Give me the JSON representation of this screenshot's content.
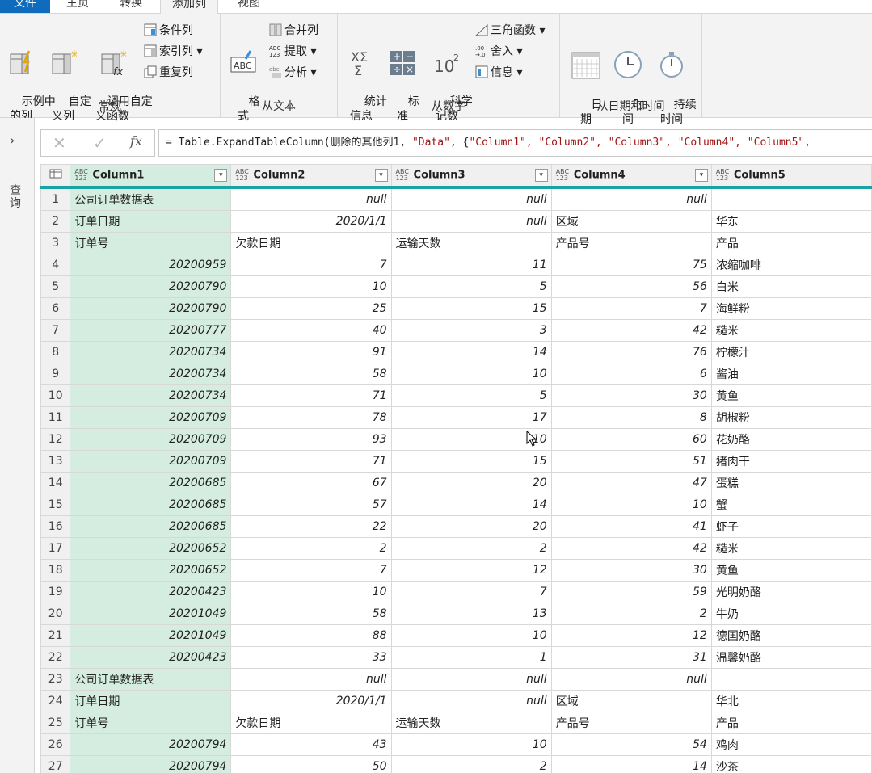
{
  "tabs": [
    "文件",
    "主页",
    "转换",
    "添加列",
    "视图"
  ],
  "ribbon": {
    "general": {
      "label": "常规",
      "example_col": "示例中\n的列",
      "custom_col": "自定\n义列",
      "invoke_func": "调用自定\n义函数",
      "conditional": "条件列",
      "index": "索引列",
      "duplicate": "重复列"
    },
    "text": {
      "label": "从文本",
      "format": "格\n式",
      "merge": "合并列",
      "extract": "提取",
      "parse": "分析"
    },
    "number": {
      "label": "从数字",
      "stats": "统计\n信息",
      "standard": "标\n准",
      "scientific": "科学\n记数",
      "trig": "三角函数",
      "round": "舍入",
      "info": "信息"
    },
    "datetime": {
      "label": "从日期和时间",
      "date": "日\n期",
      "time": "时\n间",
      "duration": "持续\n时间"
    }
  },
  "nav": {
    "label": "查询"
  },
  "formula": {
    "prefix": "= Table.ExpandTableColumn(删除的其他列1, ",
    "s1": "\"Data\"",
    "mid": ", {",
    "s2": "\"Column1\", \"Column2\", \"Column3\", \"Column4\", \"Column5\","
  },
  "columns": [
    "Column1",
    "Column2",
    "Column3",
    "Column4",
    "Column5"
  ],
  "type_icon": "ABC\n123",
  "rows": [
    [
      "1",
      "公司订单数据表",
      "null",
      "null",
      "null",
      ""
    ],
    [
      "2",
      "订单日期",
      "2020/1/1",
      "null",
      "区域",
      "华东"
    ],
    [
      "3",
      "订单号",
      "欠款日期",
      "运输天数",
      "产品号",
      "产品"
    ],
    [
      "4",
      "20200959",
      "7",
      "11",
      "75",
      "浓缩咖啡"
    ],
    [
      "5",
      "20200790",
      "10",
      "5",
      "56",
      "白米"
    ],
    [
      "6",
      "20200790",
      "25",
      "15",
      "7",
      "海鲜粉"
    ],
    [
      "7",
      "20200777",
      "40",
      "3",
      "42",
      "糙米"
    ],
    [
      "8",
      "20200734",
      "91",
      "14",
      "76",
      "柠檬汁"
    ],
    [
      "9",
      "20200734",
      "58",
      "10",
      "6",
      "酱油"
    ],
    [
      "10",
      "20200734",
      "71",
      "5",
      "30",
      "黄鱼"
    ],
    [
      "11",
      "20200709",
      "78",
      "17",
      "8",
      "胡椒粉"
    ],
    [
      "12",
      "20200709",
      "93",
      "10",
      "60",
      "花奶酪"
    ],
    [
      "13",
      "20200709",
      "71",
      "15",
      "51",
      "猪肉干"
    ],
    [
      "14",
      "20200685",
      "67",
      "20",
      "47",
      "蛋糕"
    ],
    [
      "15",
      "20200685",
      "57",
      "14",
      "10",
      "蟹"
    ],
    [
      "16",
      "20200685",
      "22",
      "20",
      "41",
      "虾子"
    ],
    [
      "17",
      "20200652",
      "2",
      "2",
      "42",
      "糙米"
    ],
    [
      "18",
      "20200652",
      "7",
      "12",
      "30",
      "黄鱼"
    ],
    [
      "19",
      "20200423",
      "10",
      "7",
      "59",
      "光明奶酪"
    ],
    [
      "20",
      "20201049",
      "58",
      "13",
      "2",
      "牛奶"
    ],
    [
      "21",
      "20201049",
      "88",
      "10",
      "12",
      "德国奶酪"
    ],
    [
      "22",
      "20200423",
      "33",
      "1",
      "31",
      "温馨奶酪"
    ],
    [
      "23",
      "公司订单数据表",
      "null",
      "null",
      "null",
      ""
    ],
    [
      "24",
      "订单日期",
      "2020/1/1",
      "null",
      "区域",
      "华北"
    ],
    [
      "25",
      "订单号",
      "欠款日期",
      "运输天数",
      "产品号",
      "产品"
    ],
    [
      "26",
      "20200794",
      "43",
      "10",
      "54",
      "鸡肉"
    ],
    [
      "27",
      "20200794",
      "50",
      "2",
      "14",
      "沙茶"
    ]
  ]
}
